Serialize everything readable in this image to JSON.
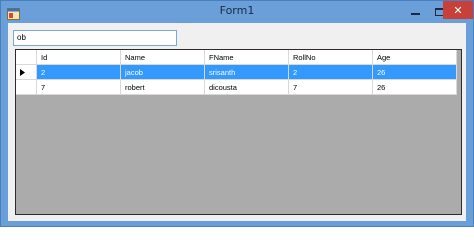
{
  "window": {
    "title": "Form1",
    "icons": {
      "app": "app-form-icon",
      "minimize": "minimize-icon",
      "maximize": "maximize-icon",
      "close": "close-icon"
    },
    "close_glyph": "✕",
    "colors": {
      "title_bar": "#6b9fd9",
      "close": "#c7403a",
      "selection": "#3399ff",
      "grid_empty": "#ababab"
    }
  },
  "search": {
    "value": "ob"
  },
  "grid": {
    "columns": [
      "Id",
      "Name",
      "FName",
      "RollNo",
      "Age"
    ],
    "rows": [
      {
        "cells": [
          "2",
          "jacob",
          "srisanth",
          "2",
          "26"
        ],
        "selected": true,
        "current_row_indicator": "▶"
      },
      {
        "cells": [
          "7",
          "robert",
          "dicousta",
          "7",
          "26"
        ],
        "selected": false
      }
    ]
  }
}
